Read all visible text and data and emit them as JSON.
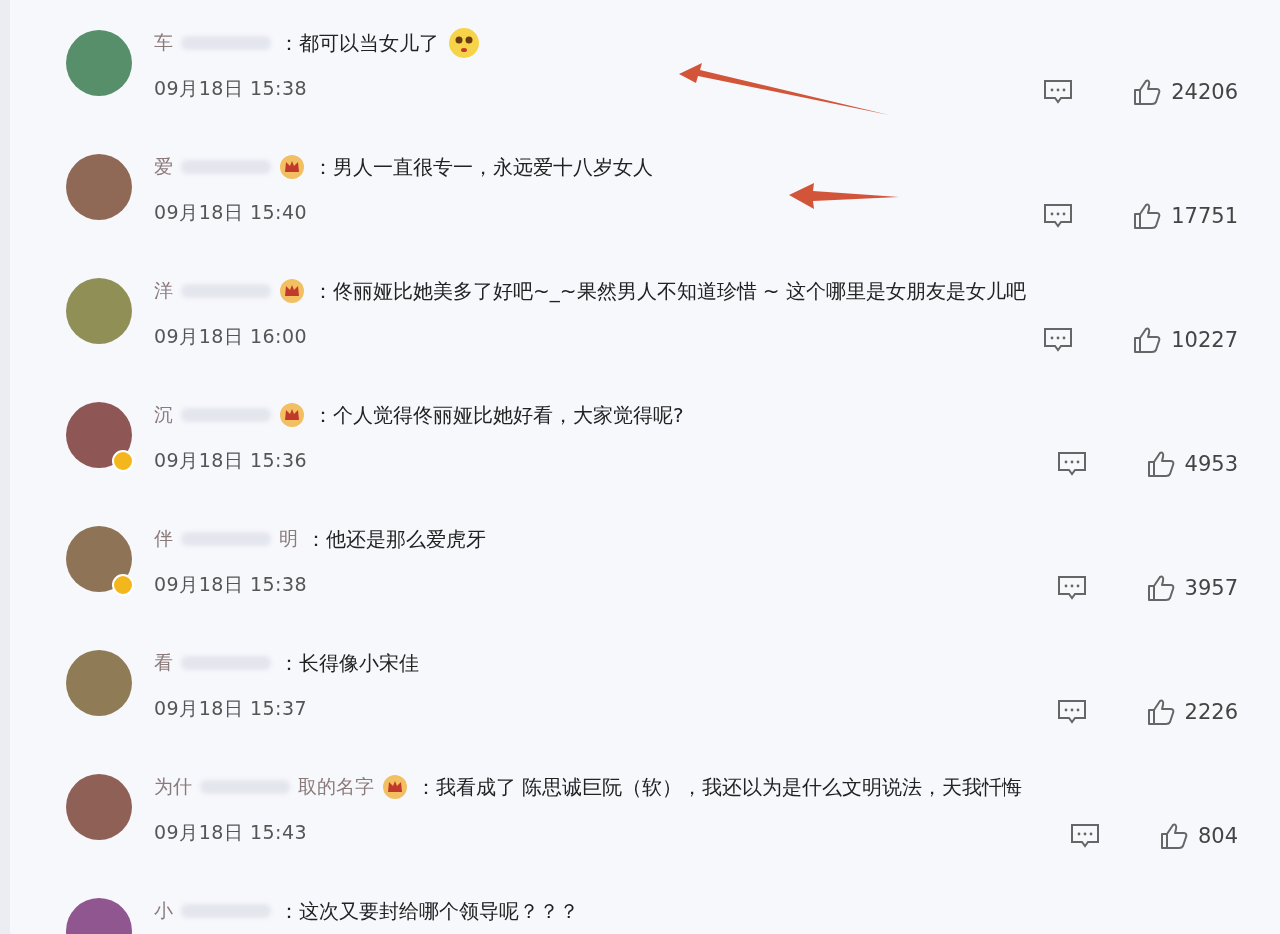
{
  "comments": [
    {
      "name": "车",
      "crown": false,
      "verified": false,
      "emoji": true,
      "text": "：都可以当女儿了",
      "time": "09月18日 15:38",
      "likes": "24206",
      "arrow": true
    },
    {
      "name": "爱",
      "crown": true,
      "verified": false,
      "emoji": false,
      "text": "：男人一直很专一，永远爱十八岁女人",
      "time": "09月18日 15:40",
      "likes": "17751",
      "arrow": true
    },
    {
      "name": "洋",
      "crown": true,
      "verified": false,
      "emoji": false,
      "text": "：佟丽娅比她美多了好吧~_~果然男人不知道珍惜 ~ 这个哪里是女朋友是女儿吧",
      "time": "09月18日 16:00",
      "likes": "10227",
      "arrow": false
    },
    {
      "name": "沉",
      "crown": true,
      "verified": true,
      "emoji": false,
      "text": "：个人觉得佟丽娅比她好看，大家觉得呢?",
      "time": "09月18日 15:36",
      "likes": "4953",
      "arrow": false
    },
    {
      "name": "伴",
      "name_end": "明",
      "crown": false,
      "verified": true,
      "emoji": false,
      "text": "：他还是那么爱虎牙",
      "time": "09月18日 15:38",
      "likes": "3957",
      "arrow": false
    },
    {
      "name": "看",
      "crown": false,
      "verified": false,
      "emoji": false,
      "text": "：长得像小宋佳",
      "time": "09月18日 15:37",
      "likes": "2226",
      "arrow": false
    },
    {
      "name": "为什",
      "name_end": "取的名字",
      "crown": true,
      "verified": false,
      "emoji": false,
      "text": "：我看成了 陈思诚巨阮（软），我还以为是什么文明说法，天我忏悔",
      "time": "09月18日 15:43",
      "likes": "804",
      "arrow": false
    },
    {
      "name": "小",
      "crown": false,
      "verified": false,
      "emoji": false,
      "text": "：这次又要封给哪个领导呢？？？",
      "arrow": false
    }
  ]
}
